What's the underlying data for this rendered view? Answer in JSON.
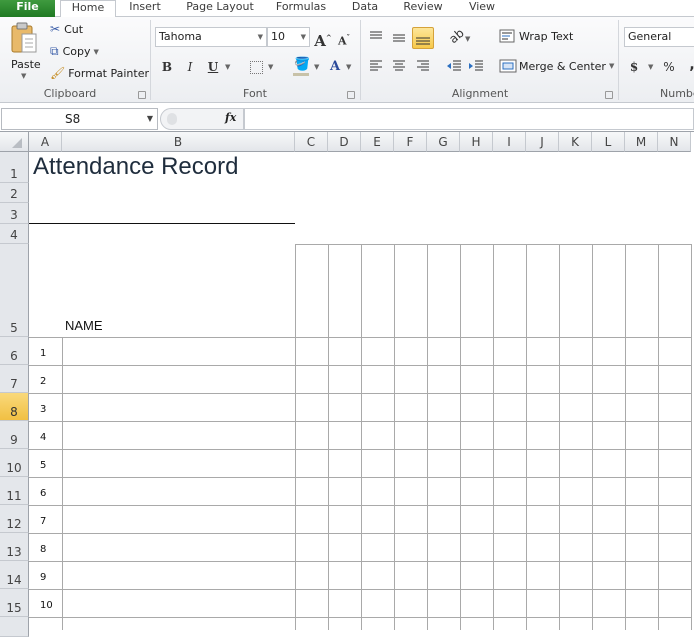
{
  "ribbon_tabs": [
    "File",
    "Home",
    "Insert",
    "Page Layout",
    "Formulas",
    "Data",
    "Review",
    "View"
  ],
  "clipboard": {
    "paste": "Paste",
    "cut": "Cut",
    "copy": "Copy",
    "format_painter": "Format Painter",
    "label": "Clipboard"
  },
  "font": {
    "name": "Tahoma",
    "size": "10",
    "label": "Font",
    "bold": "B",
    "italic": "I",
    "underline": "U",
    "grow": "A",
    "shrink": "A",
    "font_color": "A"
  },
  "alignment": {
    "wrap_text": "Wrap Text",
    "merge_center": "Merge & Center",
    "label": "Alignment"
  },
  "number": {
    "format": "General",
    "currency": "$",
    "percent": "%",
    "comma": ",",
    "label": "Number"
  },
  "formula_bar": {
    "name_box": "S8",
    "fx": "fx",
    "formula": ""
  },
  "columns": [
    "A",
    "B",
    "C",
    "D",
    "E",
    "F",
    "G",
    "H",
    "I",
    "J",
    "K",
    "L",
    "M",
    "N"
  ],
  "rows": [
    "1",
    "2",
    "3",
    "4",
    "5",
    "6",
    "7",
    "8",
    "9",
    "10",
    "11",
    "12",
    "13",
    "14",
    "15"
  ],
  "selected_row": "8",
  "sheet": {
    "title": "Attendance Record",
    "name_header": "NAME",
    "numbers": [
      "1",
      "2",
      "3",
      "4",
      "5",
      "6",
      "7",
      "8",
      "9",
      "10"
    ]
  }
}
